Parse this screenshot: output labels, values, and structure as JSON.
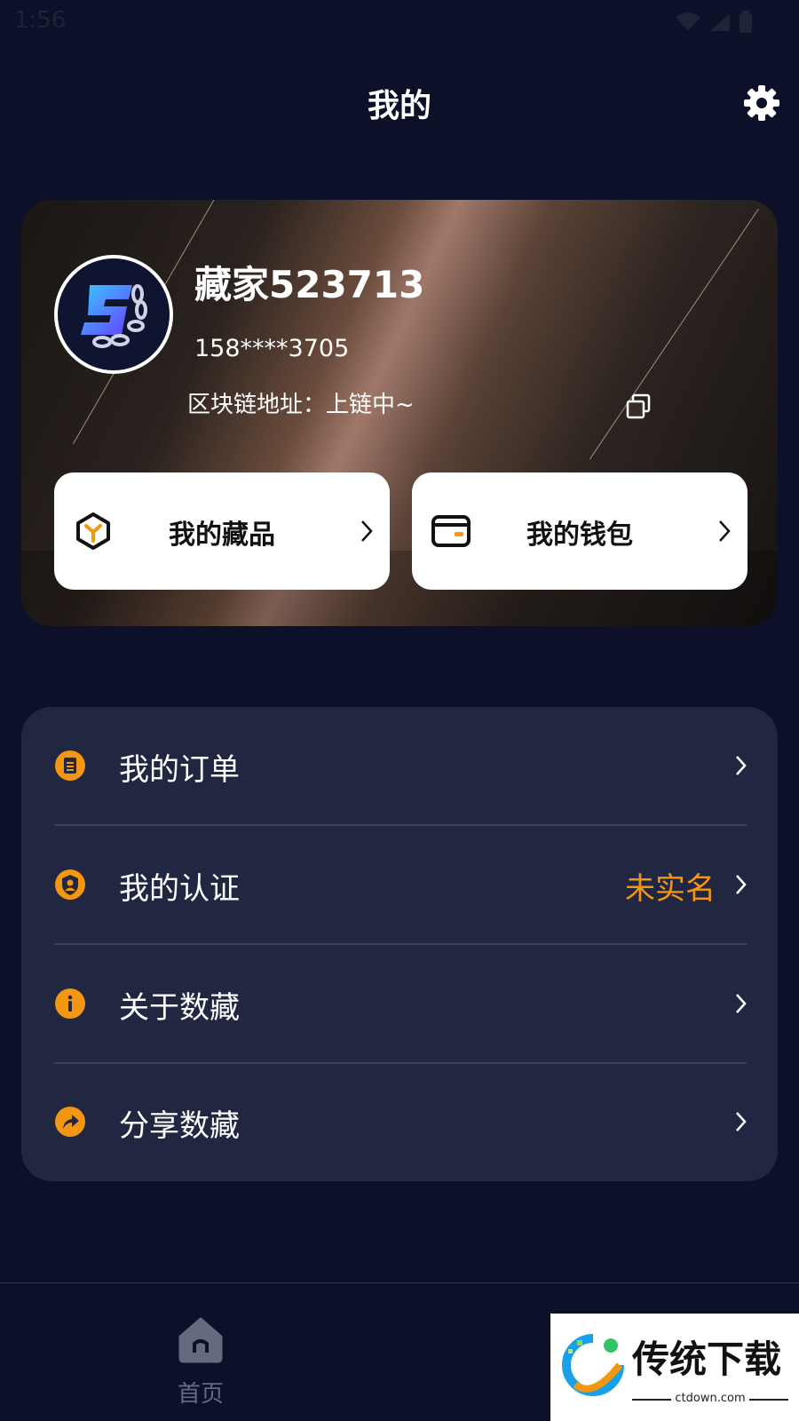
{
  "status_bar": {
    "time": "1:56",
    "icons": [
      "wifi-icon",
      "signal-icon",
      "battery-icon"
    ]
  },
  "header": {
    "title": "我的",
    "settings_icon": "gear-icon"
  },
  "profile": {
    "username": "藏家523713",
    "phone": "158****3705",
    "chain_label": "区块链地址：",
    "chain_value": "上链中~"
  },
  "quick_actions": [
    {
      "label": "我的藏品",
      "icon": "collection-icon"
    },
    {
      "label": "我的钱包",
      "icon": "wallet-icon"
    }
  ],
  "menu": [
    {
      "label": "我的订单",
      "value": "",
      "icon": "order-icon"
    },
    {
      "label": "我的认证",
      "value": "未实名",
      "icon": "verification-icon"
    },
    {
      "label": "关于数藏",
      "value": "",
      "icon": "info-icon"
    },
    {
      "label": "分享数藏",
      "value": "",
      "icon": "share-icon"
    }
  ],
  "tabbar": {
    "home_label": "首页"
  },
  "watermark": {
    "brand": "传统下载",
    "domain": "ctdown.com"
  },
  "colors": {
    "background": "#0c1129",
    "card": "#212741",
    "accent": "#f39712",
    "white": "#ffffff"
  }
}
